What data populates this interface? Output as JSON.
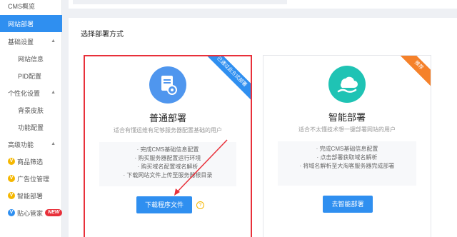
{
  "sidebar": {
    "items": [
      {
        "label": "CMS概览",
        "active": false
      },
      {
        "label": "网站部署",
        "active": true
      },
      {
        "label": "基础设置"
      },
      {
        "label": "网站信息"
      },
      {
        "label": "PID配置"
      },
      {
        "label": "个性化设置"
      },
      {
        "label": "背景皮肤"
      },
      {
        "label": "功能配置"
      },
      {
        "label": "高级功能"
      },
      {
        "label": "商品筛选"
      },
      {
        "label": "广告位管理"
      },
      {
        "label": "智能部署"
      },
      {
        "label": "贴心管家"
      }
    ],
    "new_badge": "NEW"
  },
  "panel": {
    "title": "选择部署方式"
  },
  "cards": {
    "normal": {
      "ribbon": "已通过此方式部署",
      "name": "普通部署",
      "desc": "适合有懂运维有足够服务器配置基础的用户",
      "steps": [
        "· 完成CMS基础信息配置",
        "· 购买服务器配置运行环境",
        "· 购买域名配置域名解析",
        "· 下载网站文件上传至服务器根目录"
      ],
      "button": "下载程序文件",
      "help": "?"
    },
    "smart": {
      "ribbon": "推荐",
      "name": "智能部署",
      "desc": "适合不太懂技术想一键部署网站的用户",
      "steps": [
        "· 完成CMS基础信息配置",
        "· 点击部署获取域名解析",
        "· 将域名解析至大淘客服务器完成部署"
      ],
      "button": "去智能部署"
    }
  },
  "colors": {
    "accent": "#2f8ff0",
    "highlight": "#e8303a",
    "teal": "#1fc3b4",
    "orange": "#f5812a"
  }
}
